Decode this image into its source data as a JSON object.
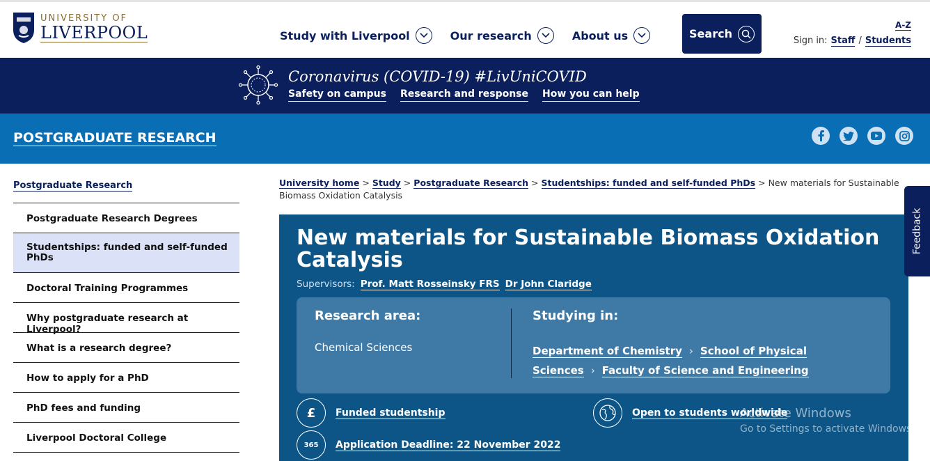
{
  "header": {
    "logo_top": "UNIVERSITY OF",
    "logo_bottom": "LIVERPOOL",
    "nav": [
      "Study with Liverpool",
      "Our research",
      "About us"
    ],
    "search_label": "Search",
    "az_label": "A-Z",
    "signin_label": "Sign in:",
    "signin_staff": "Staff",
    "signin_sep": "/",
    "signin_students": "Students"
  },
  "covid": {
    "title": "Coronavirus (COVID-19) #LivUniCOVID",
    "links": [
      "Safety on campus",
      "Research and response",
      "How you can help"
    ]
  },
  "section": {
    "title": "POSTGRADUATE RESEARCH",
    "social_icons": [
      "facebook-icon",
      "twitter-icon",
      "youtube-icon",
      "instagram-icon"
    ]
  },
  "sidebar": {
    "heading": "Postgraduate Research",
    "items": [
      "Postgraduate Research Degrees",
      "Studentships: funded and self-funded PhDs",
      "Doctoral Training Programmes",
      "Why postgraduate research at Liverpool?",
      "What is a research degree?",
      "How to apply for a PhD",
      "PhD fees and funding",
      "Liverpool Doctoral College"
    ],
    "active_index": 1
  },
  "breadcrumb": {
    "links": [
      "University home",
      "Study",
      "Postgraduate Research",
      "Studentships: funded and self-funded PhDs"
    ],
    "separator": ">",
    "current": "New materials for Sustainable Biomass Oxidation Catalysis"
  },
  "hero": {
    "title": "New materials for Sustainable Biomass Oxidation Catalysis",
    "supervisors_label": "Supervisors:",
    "supervisors": [
      "Prof. Matt Rosseinsky FRS",
      "Dr John Claridge"
    ],
    "research_area_label": "Research area:",
    "research_area": "Chemical Sciences",
    "studying_in_label": "Studying in:",
    "studying_in": [
      "Department of Chemistry",
      "School of Physical Sciences",
      "Faculty of Science and Engineering"
    ],
    "features": {
      "funded": "Funded studentship",
      "worldwide": "Open to students worldwide",
      "deadline": "Application Deadline: 22 November 2022",
      "deadline_icon_text": "365"
    }
  },
  "feedback_label": "Feedback",
  "watermark": {
    "line1": "Activate Windows",
    "line2": "Go to Settings to activate Windows."
  },
  "colors": {
    "navy": "#0b1f5c",
    "blue_bar": "#0a6eb4",
    "hero_bg": "#0d5586",
    "card_bg": "#3f7aa6",
    "active_bg": "#dbe2f7"
  }
}
